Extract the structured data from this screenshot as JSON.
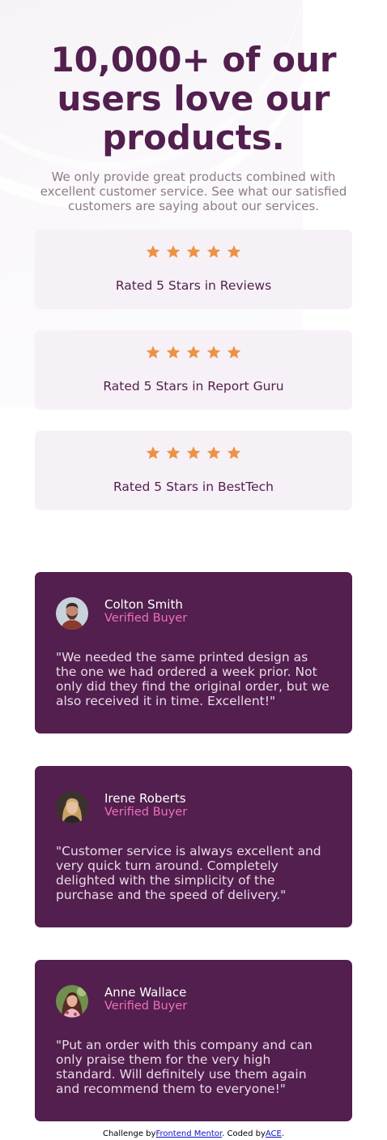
{
  "headline": "10,000+ of our users love our products.",
  "intro": "We only provide great products combined with excellent customer service. See what our satisfied customers are saying about our services.",
  "star_color": "#ed9244",
  "ratings": [
    {
      "label": "Rated 5 Stars in Reviews",
      "stars": 5
    },
    {
      "label": "Rated 5 Stars in Report Guru",
      "stars": 5
    },
    {
      "label": "Rated 5 Stars in BestTech",
      "stars": 5
    }
  ],
  "reviews": [
    {
      "name": "Colton Smith",
      "status": "Verified Buyer",
      "quote": "\"We needed the same printed design as the one we had ordered a week prior. Not only did they find the original order, but we also received it in time. Excellent!\""
    },
    {
      "name": "Irene Roberts",
      "status": "Verified Buyer",
      "quote": "\"Customer service is always excellent and very quick turn around. Completely delighted with the simplicity of the purchase and the speed of delivery.\""
    },
    {
      "name": "Anne Wallace",
      "status": "Verified Buyer",
      "quote": "\"Put an order with this company and can only praise them for the very high standard. Will definitely use them again and recommend them to everyone!\""
    }
  ],
  "footer": {
    "prefix": "Challenge by",
    "link1": "Frontend Mentor",
    "middle": ". Coded by",
    "link2": "ACE",
    "suffix": "."
  }
}
